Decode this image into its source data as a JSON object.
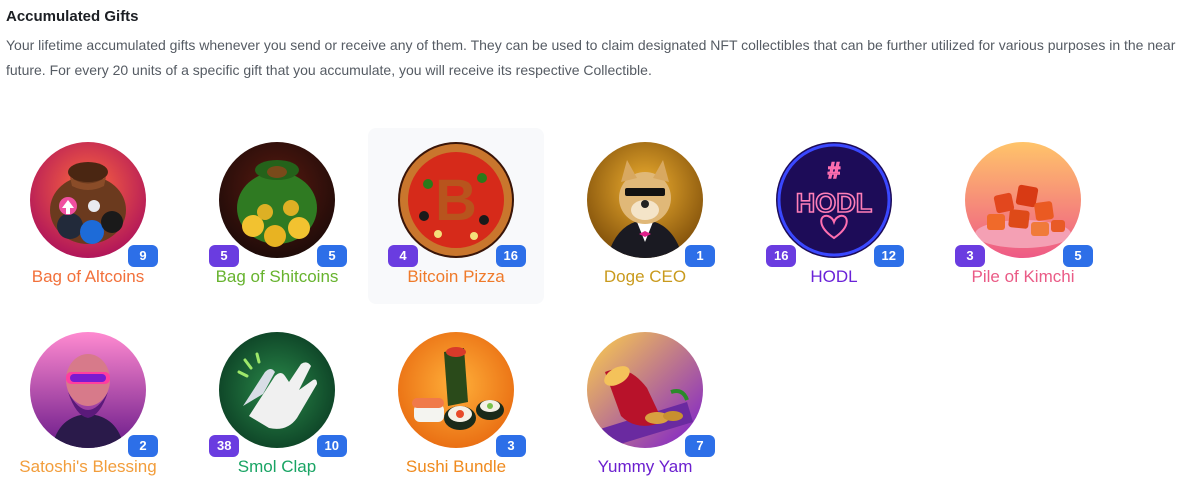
{
  "section": {
    "title": "Accumulated Gifts",
    "description": "Your lifetime accumulated gifts whenever you send or receive any of them. They can be used to claim designated NFT collectibles that can be further utilized for various purposes in the near future. For every 20 units of a specific gift that you accumulate, you will receive its respective Collectible."
  },
  "gifts": [
    {
      "name": "Bag of Altcoins",
      "color": "#f2703a",
      "received": "",
      "sent": "9",
      "icon": "bag-of-altcoins-icon"
    },
    {
      "name": "Bag of Shitcoins",
      "color": "#67b32e",
      "received": "5",
      "sent": "5",
      "icon": "bag-of-shitcoins-icon"
    },
    {
      "name": "Bitcoin Pizza",
      "color": "#ef7a2a",
      "received": "4",
      "sent": "16",
      "icon": "bitcoin-pizza-icon"
    },
    {
      "name": "Doge CEO",
      "color": "#c99a1d",
      "received": "",
      "sent": "1",
      "icon": "doge-ceo-icon"
    },
    {
      "name": "HODL",
      "color": "#6a22d8",
      "received": "16",
      "sent": "12",
      "icon": "hodl-neon-icon"
    },
    {
      "name": "Pile of Kimchi",
      "color": "#ea5b86",
      "received": "3",
      "sent": "5",
      "icon": "pile-of-kimchi-icon"
    },
    {
      "name": "Satoshi's Blessing",
      "color": "#f29d3b",
      "received": "",
      "sent": "2",
      "icon": "satoshis-blessing-icon"
    },
    {
      "name": "Smol Clap",
      "color": "#19a464",
      "received": "38",
      "sent": "10",
      "icon": "smol-clap-icon"
    },
    {
      "name": "Sushi Bundle",
      "color": "#ef8a1e",
      "received": "",
      "sent": "3",
      "icon": "sushi-bundle-icon"
    },
    {
      "name": "Yummy Yam",
      "color": "#6b1fcf",
      "received": "",
      "sent": "7",
      "icon": "yummy-yam-icon"
    }
  ]
}
